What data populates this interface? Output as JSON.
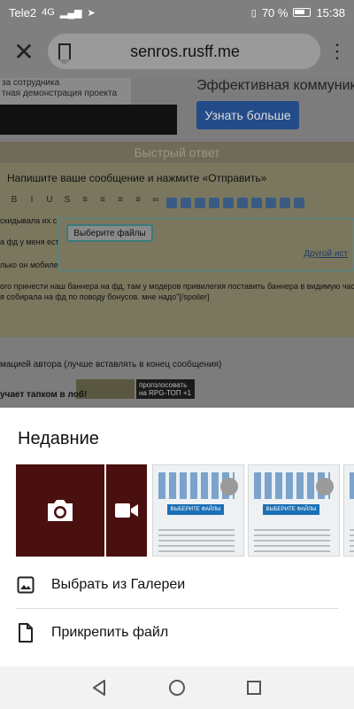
{
  "status_bar": {
    "carrier": "Tele2",
    "network": "4G",
    "battery": "70 %",
    "time": "15:38"
  },
  "browser": {
    "url": "senros.rusff.me",
    "close_icon": "close-icon",
    "bookmark_icon": "bookmark-icon",
    "menu_icon": "more-vert-icon"
  },
  "page": {
    "ad_left_line1": "за сотрудника",
    "ad_left_line2": "тная демонстрация проекта",
    "ad_right_text": "Эффективная коммуника",
    "ad_button": "Узнать больше",
    "quick_reply": "Быстрый ответ",
    "editor_hint": "Напишите ваше сообщение и нажмите «Отправить»",
    "text1": "скидывала их с",
    "text2": "а фд у меня есть",
    "text3": "лько он мобиле",
    "text4": "ого принести наш баннера на фд, там у модеров привилегия поставить баннера в видимую час",
    "text5": "я собирала на фд по поводу бонусов. мне надо\"[/spoiler]",
    "choose_files": "Выберите файлы",
    "other_source": "Другой ист",
    "signature": "мацией автора (лучше вставлять в конец сообщения)",
    "bottom_text": "учает тапком в лоб!",
    "banner2_text": "проголосовать на RPG-ТОП +1"
  },
  "sheet": {
    "title": "Недавние",
    "thumb_button_text": "ВЫБЕРИТЕ ФАЙЛЫ",
    "gallery_label": "Выбрать из Галереи",
    "attach_label": "Прикрепить файл"
  },
  "colors": {
    "dim_overlay": "#7f7f7f",
    "ad_button": "#234b8a",
    "sheet_bg": "#ffffff",
    "thumb_red": "#4a0f0f"
  }
}
